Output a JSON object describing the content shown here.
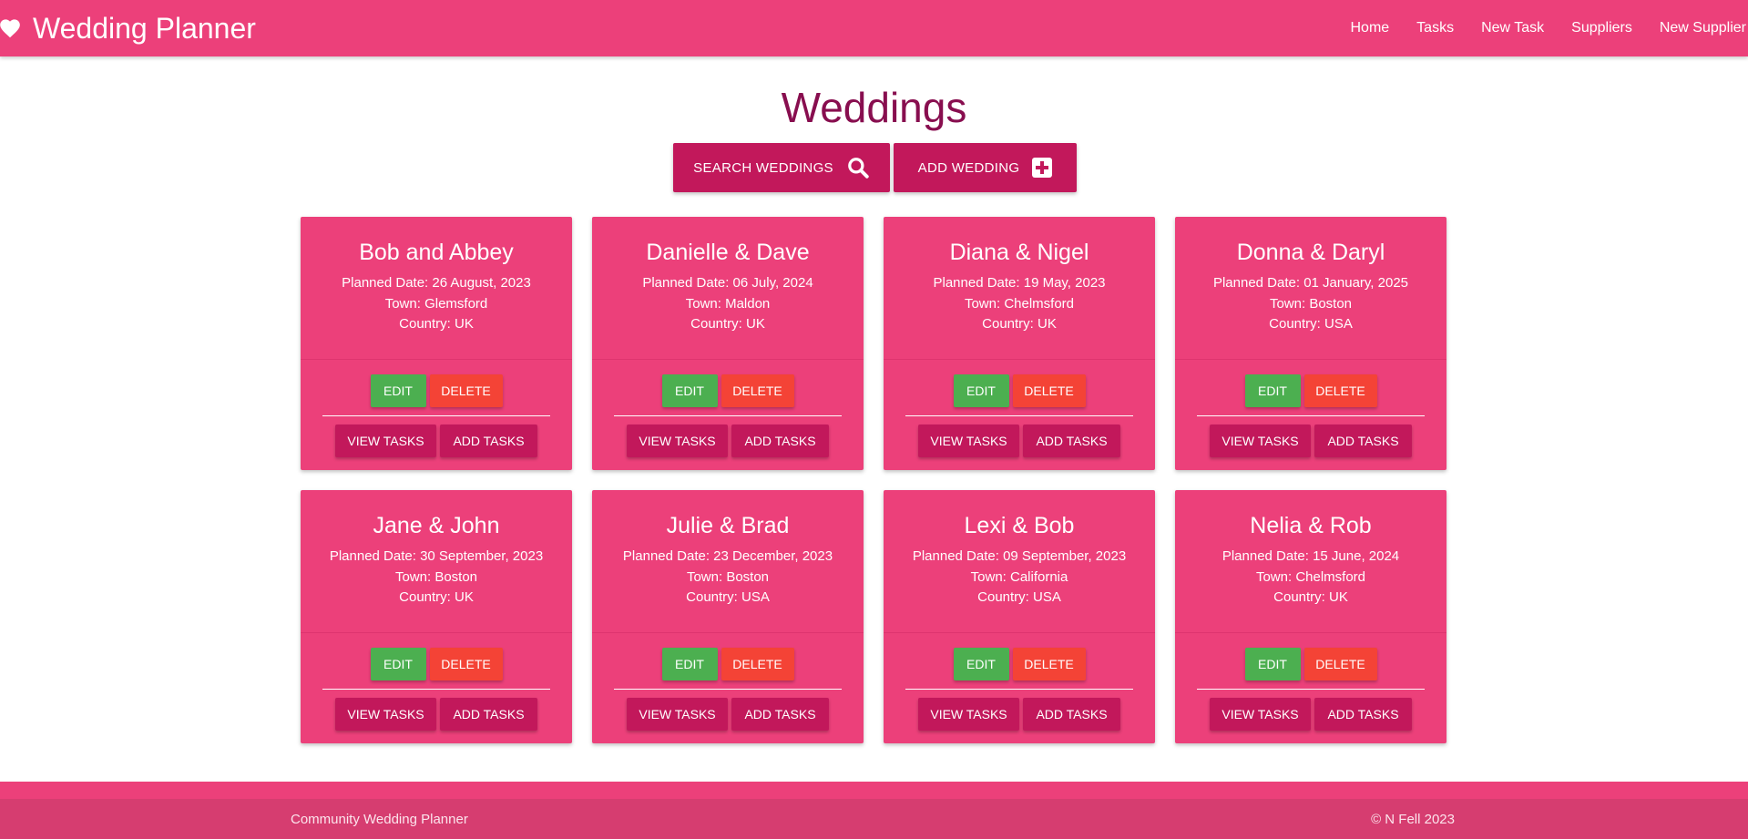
{
  "app": {
    "brand": "Wedding Planner",
    "brand_icon": "heart-icon",
    "nav": [
      "Home",
      "Tasks",
      "New Task",
      "Suppliers",
      "New Supplier"
    ]
  },
  "page": {
    "title": "Weddings",
    "search_label": "SEARCH WEDDINGS",
    "search_icon": "search-icon",
    "add_label": "ADD WEDDING",
    "add_icon": "plus-square-icon"
  },
  "card_labels": {
    "edit": "EDIT",
    "delete": "DELETE",
    "view_tasks": "VIEW TASKS",
    "add_tasks": "ADD TASKS"
  },
  "weddings": [
    {
      "title": "Bob and Abbey",
      "date": "Planned Date: 26 August, 2023",
      "town": "Town: Glemsford",
      "country": "Country: UK"
    },
    {
      "title": "Danielle & Dave",
      "date": "Planned Date: 06 July, 2024",
      "town": "Town: Maldon",
      "country": "Country: UK"
    },
    {
      "title": "Diana & Nigel",
      "date": "Planned Date: 19 May, 2023",
      "town": "Town: Chelmsford",
      "country": "Country: UK"
    },
    {
      "title": "Donna & Daryl",
      "date": "Planned Date: 01 January, 2025",
      "town": "Town: Boston",
      "country": "Country: USA"
    },
    {
      "title": "Jane & John",
      "date": "Planned Date: 30 September, 2023",
      "town": "Town: Boston",
      "country": "Country: UK"
    },
    {
      "title": "Julie & Brad",
      "date": "Planned Date: 23 December, 2023",
      "town": "Town: Boston",
      "country": "Country: USA"
    },
    {
      "title": "Lexi & Bob",
      "date": "Planned Date: 09 September, 2023",
      "town": "Town: California",
      "country": "Country: USA"
    },
    {
      "title": "Nelia & Rob",
      "date": "Planned Date: 15 June, 2024",
      "town": "Town: Chelmsford",
      "country": "Country: UK"
    }
  ],
  "footer": {
    "left": "Community Wedding Planner",
    "right": "© N Fell 2023"
  },
  "colors": {
    "primary": "#ec407a",
    "dark": "#c2185b",
    "title": "#880e4f",
    "edit": "#4caf50",
    "delete": "#f44336"
  }
}
